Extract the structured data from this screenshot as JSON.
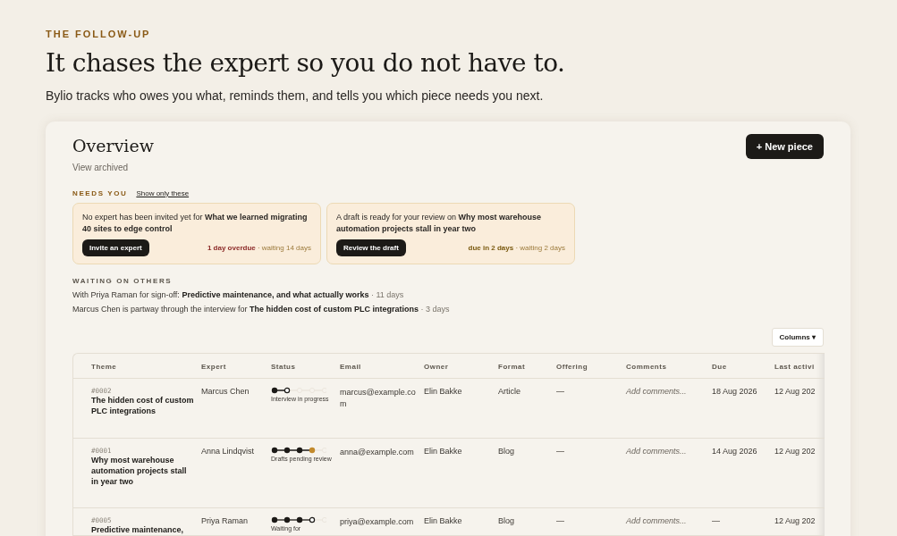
{
  "eyebrow": "THE FOLLOW-UP",
  "headline": "It chases the expert so you do not have to.",
  "subhead": "Bylio tracks who owes you what, reminds them, and tells you which piece needs you next.",
  "overview": {
    "title": "Overview",
    "archived_link": "View archived",
    "new_button": "+ New piece"
  },
  "needs_you": {
    "heading": "NEEDS YOU",
    "filter_link": "Show only these",
    "cards": [
      {
        "text": "No expert has been invited yet for **What we learned migrating 40 sites to edge control**",
        "button": "Invite an expert",
        "urgency": "1 day overdue",
        "color": "#8c2a28",
        "waiting": " · waiting 14 days"
      },
      {
        "text": "A draft is ready for your review on **Why most warehouse automation projects stall in year two**",
        "button": "Review the draft",
        "urgency": "due in 2 days",
        "color": "#7a5a10",
        "waiting": " · waiting 2 days"
      }
    ]
  },
  "waiting_on_others": {
    "heading": "WAITING ON OTHERS",
    "items": [
      {
        "text": "With Priya Raman for sign-off: **Predictive maintenance, and what actually works**",
        "age": " · 11 days"
      },
      {
        "text": "Marcus Chen is partway through the interview for **The hidden cost of custom PLC integrations**",
        "age": " · 3 days"
      }
    ]
  },
  "columns_button": "Columns ▾",
  "table": {
    "columns": [
      "Theme",
      "Expert",
      "Status",
      "Email",
      "Owner",
      "Format",
      "Offering",
      "Comments",
      "Due",
      "Last activi"
    ],
    "rows": [
      {
        "id": "#0002",
        "theme": "The hidden cost of custom PLC integrations",
        "expert": "Marcus Chen",
        "steps": [
          {
            "kind": "done"
          },
          {
            "kind": "current"
          },
          {
            "kind": "todo"
          },
          {
            "kind": "todo"
          },
          {
            "kind": "todo"
          }
        ],
        "status": "Interview in progress",
        "email": "marcus@example.com",
        "owner": "Elin Bakke",
        "format": "Article",
        "offering": "—",
        "comments_placeholder": "Add comments...",
        "due": "18 Aug 2026",
        "last_activity": "12 Aug 202"
      },
      {
        "id": "#0001",
        "theme": "Why most warehouse automation projects stall in year two",
        "expert": "Anna Lindqvist",
        "steps": [
          {
            "kind": "done"
          },
          {
            "kind": "done"
          },
          {
            "kind": "done"
          },
          {
            "kind": "review"
          },
          {
            "kind": "todo"
          }
        ],
        "status": "Drafts pending review",
        "email": "anna@example.com",
        "owner": "Elin Bakke",
        "format": "Blog",
        "offering": "—",
        "comments_placeholder": "Add comments...",
        "due": "14 Aug 2026",
        "last_activity": "12 Aug 202"
      },
      {
        "id": "#0005",
        "theme": "Predictive maintenance,",
        "expert": "Priya Raman",
        "steps": [
          {
            "kind": "done"
          },
          {
            "kind": "done"
          },
          {
            "kind": "done"
          },
          {
            "kind": "current"
          },
          {
            "kind": "todo"
          }
        ],
        "status": "Waiting for",
        "email": "priya@example.com",
        "owner": "Elin Bakke",
        "format": "Blog",
        "offering": "—",
        "comments_placeholder": "Add comments...",
        "due": "—",
        "last_activity": "12 Aug 202"
      }
    ]
  }
}
